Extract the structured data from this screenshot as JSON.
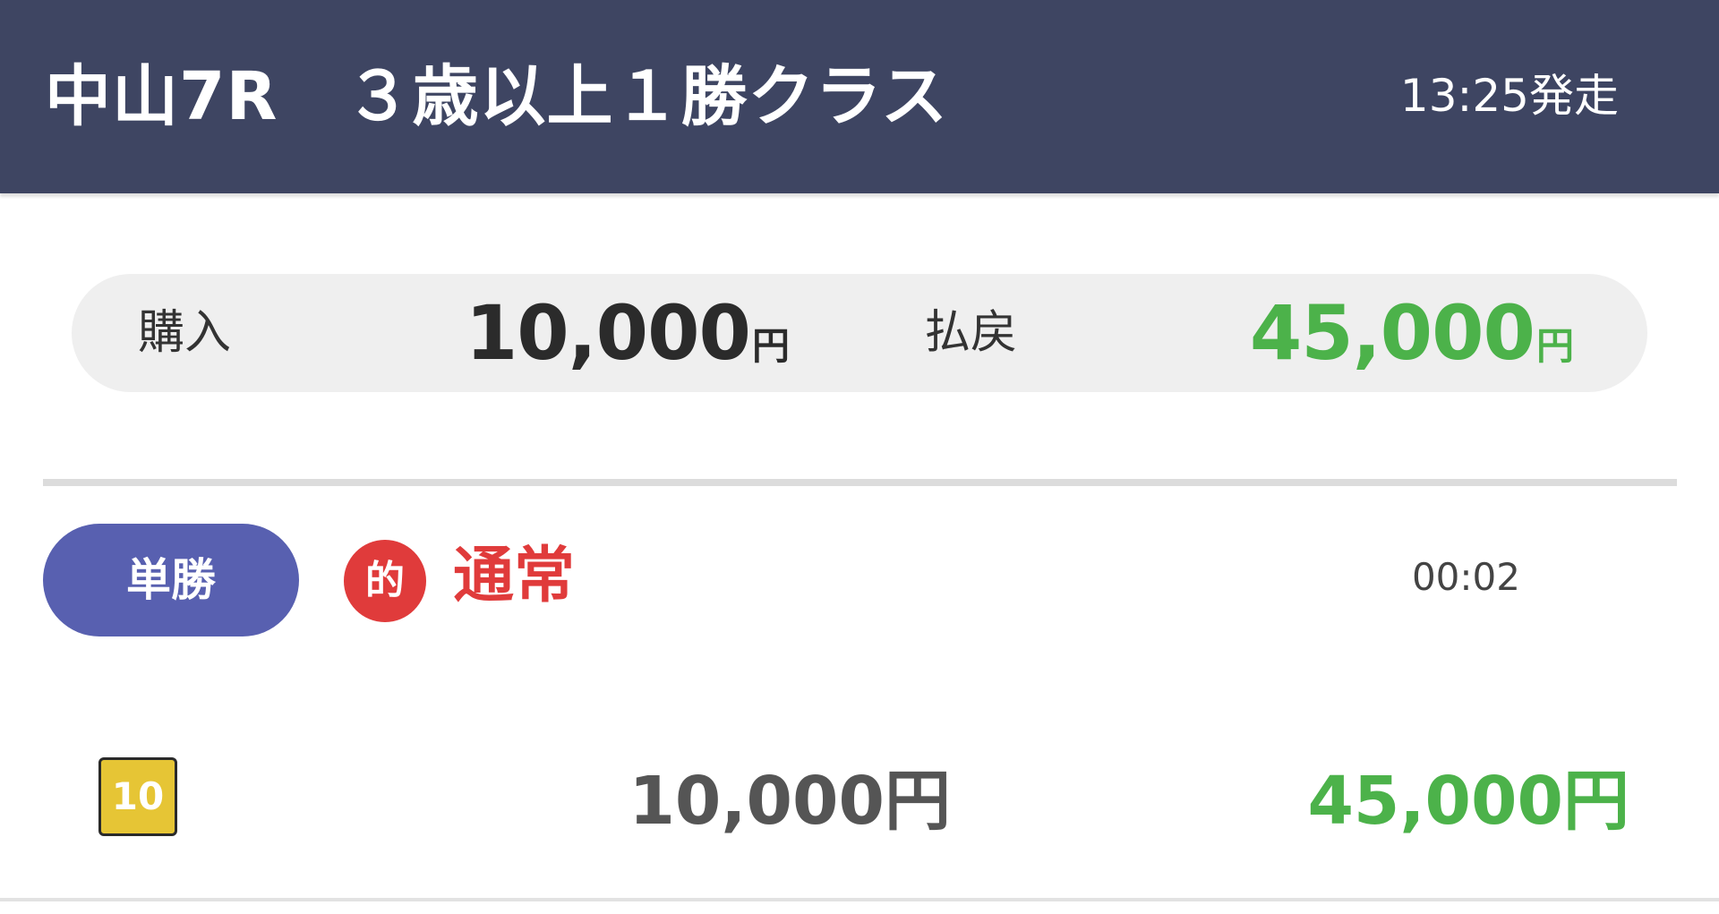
{
  "header": {
    "race_title": "中山7R　３歳以上１勝クラス",
    "start_time": "13:25発走"
  },
  "summary": {
    "purchase_label": "購入",
    "purchase_amount": "10,000",
    "purchase_unit": "円",
    "payout_label": "払戻",
    "payout_amount": "45,000",
    "payout_unit": "円"
  },
  "bet": {
    "type": "単勝",
    "hit_icon": "的",
    "mode": "通常",
    "time": "00:02",
    "horse_number": "10",
    "stake": "10,000円",
    "payout": "45,000円"
  },
  "colors": {
    "header_bg": "#3e4562",
    "payout_green": "#4cb24a",
    "hit_red": "#e03b3b",
    "badge_blue": "#5860b0",
    "horse_frame_yellow": "#e6c535"
  }
}
